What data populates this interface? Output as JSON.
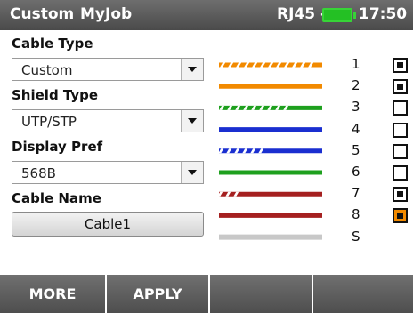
{
  "status_bar": {
    "mode": "Custom",
    "job": "MyJob",
    "connector": "RJ45 -",
    "time": "17:50",
    "battery_icon": "battery-full-icon"
  },
  "form": {
    "cable_type_label": "Cable Type",
    "cable_type_value": "Custom",
    "shield_type_label": "Shield Type",
    "shield_type_value": "UTP/STP",
    "display_pref_label": "Display Pref",
    "display_pref_value": "568B",
    "cable_name_label": "Cable Name",
    "cable_name_value": "Cable1"
  },
  "wires": [
    {
      "number": "1",
      "color": "#f28a00",
      "striped": true,
      "checked": true,
      "selected": false
    },
    {
      "number": "2",
      "color": "#f28a00",
      "striped": false,
      "checked": true,
      "selected": false
    },
    {
      "number": "3",
      "color": "#1ea01e",
      "striped": true,
      "checked": false,
      "selected": false
    },
    {
      "number": "4",
      "color": "#1a2fd0",
      "striped": false,
      "checked": false,
      "selected": false
    },
    {
      "number": "5",
      "color": "#1a2fd0",
      "striped": true,
      "checked": false,
      "selected": false
    },
    {
      "number": "6",
      "color": "#1ea01e",
      "striped": false,
      "checked": false,
      "selected": false
    },
    {
      "number": "7",
      "color": "#a52020",
      "striped": true,
      "checked": true,
      "selected": false
    },
    {
      "number": "8",
      "color": "#a52020",
      "striped": false,
      "checked": true,
      "selected": true
    },
    {
      "number": "S",
      "color": "#c8c8c8",
      "striped": false,
      "checked": false,
      "selected": false
    }
  ],
  "softkeys": [
    {
      "label": "MORE"
    },
    {
      "label": "APPLY"
    },
    {
      "label": ""
    },
    {
      "label": ""
    }
  ],
  "colors": {
    "selected_accent": "#f28a00",
    "battery": "#24c024"
  }
}
